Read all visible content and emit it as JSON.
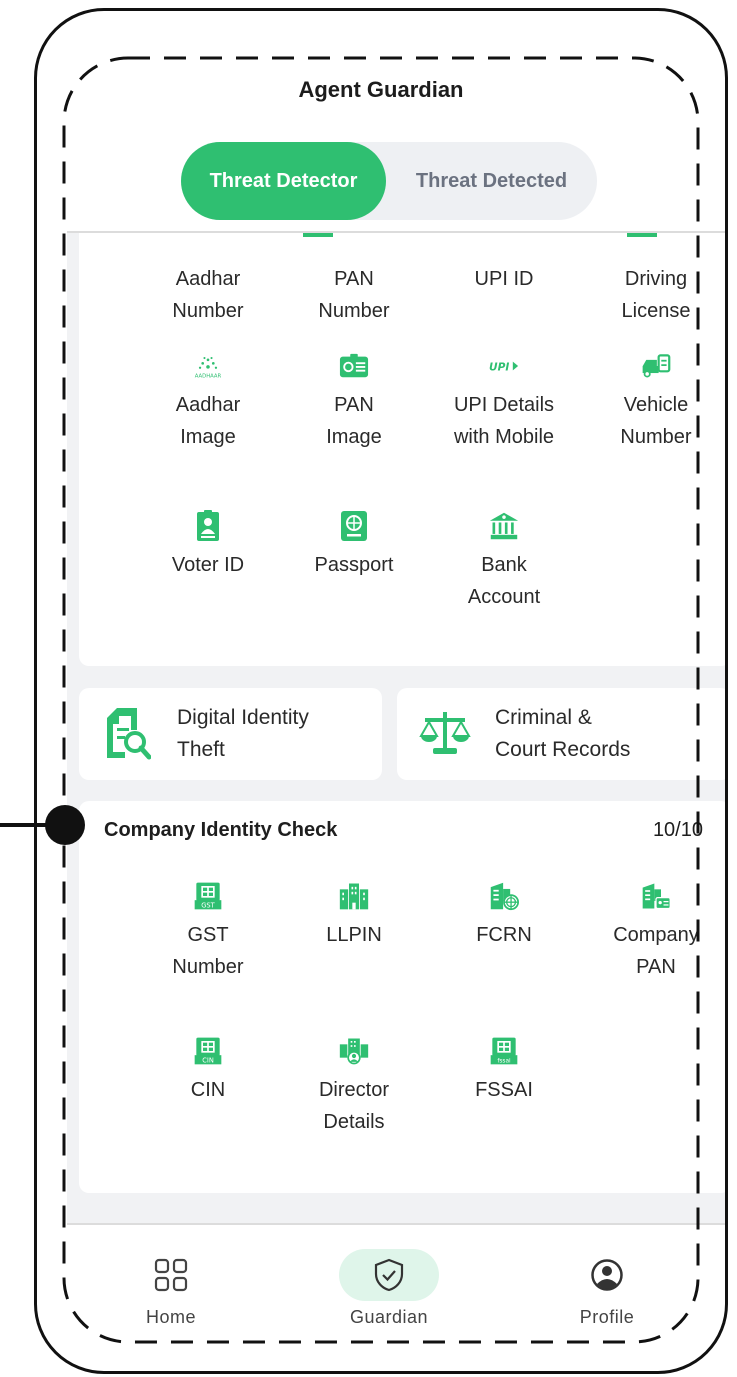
{
  "app": {
    "title": "Agent Guardian"
  },
  "toggle": {
    "active_label": "Threat Detector",
    "inactive_label": "Threat Detected"
  },
  "identity_grid": {
    "row1": [
      "Aadhar\nNumber",
      "PAN\nNumber",
      "UPI ID",
      "Driving\nLicense"
    ],
    "row2": [
      "Aadhar\nImage",
      "PAN\nImage",
      "UPI Details\nwith Mobile",
      "Vehicle\nNumber"
    ],
    "row3": [
      "Voter ID",
      "Passport",
      "Bank\nAccount"
    ],
    "icons": {
      "row2": [
        "aadhaar-logo-icon",
        "pan-card-icon",
        "upi-logo-icon",
        "vehicle-icon"
      ],
      "row3": [
        "voter-id-icon",
        "passport-icon",
        "bank-icon"
      ]
    }
  },
  "feature_cards": {
    "digital": "Digital Identity\nTheft",
    "criminal": "Criminal &\nCourt Records"
  },
  "company": {
    "title": "Company Identity Check",
    "count": "10/10",
    "row1": [
      "GST\nNumber",
      "LLPIN",
      "FCRN",
      "Company\nPAN"
    ],
    "row2": [
      "CIN",
      "Director\nDetails",
      "FSSAI"
    ],
    "icon_labels": {
      "gst": "GST",
      "cin": "CIN",
      "fssai": "fssai",
      "aadhaar": "AADHAAR",
      "upi": "UPI"
    }
  },
  "bottom_nav": {
    "home": "Home",
    "guardian": "Guardian",
    "profile": "Profile"
  },
  "colors": {
    "accent": "#2fbf71",
    "accent_light": "#dff5ea",
    "bg": "#f1f2f4"
  }
}
